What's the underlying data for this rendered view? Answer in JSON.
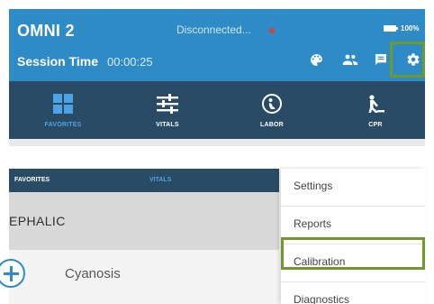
{
  "header": {
    "app_title": "OMNI 2",
    "connection_status": "Disconnected...",
    "battery": "100%",
    "session_label": "Session Time",
    "session_time": "00:00:25",
    "icons": [
      "palette-icon",
      "people-icon",
      "chat-icon",
      "gear-icon"
    ]
  },
  "tabs": [
    {
      "label": "FAVORITES",
      "icon": "grid-icon",
      "active": true
    },
    {
      "label": "VITALS",
      "icon": "sliders-icon",
      "active": false
    },
    {
      "label": "LABOR",
      "icon": "labor-icon",
      "active": false
    },
    {
      "label": "CPR",
      "icon": "cpr-icon",
      "active": false
    }
  ],
  "lower": {
    "tabs": [
      {
        "label": "FAVORITES",
        "active": false
      },
      {
        "label": "VITALS",
        "active": true
      }
    ],
    "section_title": "EPHALIC",
    "list_item": "Cyanosis",
    "menu": [
      {
        "label": "Settings",
        "highlighted": false
      },
      {
        "label": "Reports",
        "highlighted": false
      },
      {
        "label": "Calibration",
        "highlighted": true
      },
      {
        "label": "Diagnostics",
        "highlighted": false
      }
    ]
  },
  "colors": {
    "header_blue": "#2e8bc6",
    "tabbar_navy": "#2a4b66",
    "active_tab": "#4da3e3",
    "highlight_green": "#6e9a2d",
    "status_red": "#e53935"
  }
}
